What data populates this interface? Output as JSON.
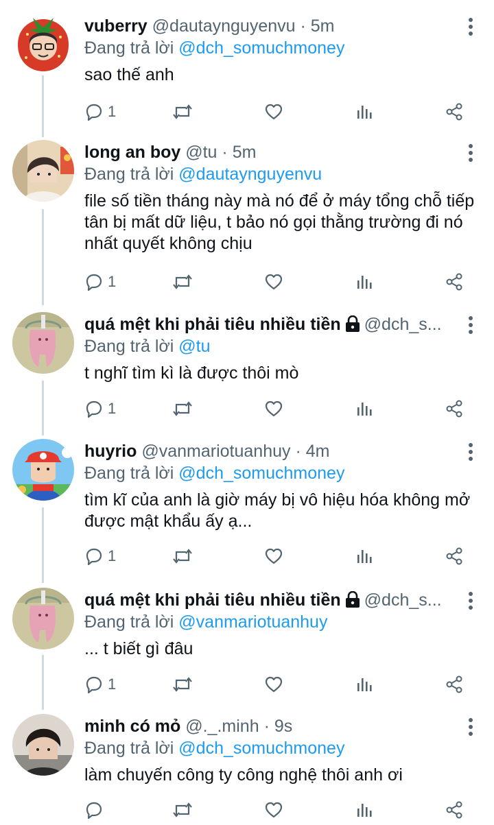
{
  "tweets": [
    {
      "name": "vuberry",
      "handle": "@dautaynguyenvu",
      "time": "· 5m",
      "reply_label": "Đang trả lời",
      "reply_to": "@dch_somuchmoney",
      "text": "sao thế anh",
      "reply_count": "1",
      "avatar_icon": "strawberry-avatar-icon",
      "locked": false
    },
    {
      "name": "long an boy",
      "handle": "@tu",
      "time": "· 5m",
      "reply_label": "Đang trả lời",
      "reply_to": "@dautaynguyenvu",
      "text": "file số tiền tháng này mà nó để ở máy tổng chỗ tiếp tân bị mất dữ liệu, t bảo nó gọi thằng trường đi nó nhất quyết không chịu",
      "reply_count": "1",
      "avatar_icon": "person-photo-avatar-icon",
      "locked": false
    },
    {
      "name": "quá mệt khi phải tiêu nhiều tiền",
      "handle": "@dch_s...",
      "time": "",
      "reply_label": "Đang trả lời",
      "reply_to": "@tu",
      "text": "t nghĩ tìm kì là được thôi mò",
      "reply_count": "1",
      "avatar_icon": "pink-figure-avatar-icon",
      "locked": true
    },
    {
      "name": "huyrio",
      "handle": "@vanmariotuanhuy",
      "time": "· 4m",
      "reply_label": "Đang trả lời",
      "reply_to": "@dch_somuchmoney",
      "text": "tìm kĩ của anh là giờ máy bị vô hiệu hóa không mở được mật khẩu ấy ạ...",
      "reply_count": "1",
      "avatar_icon": "mario-avatar-icon",
      "locked": false
    },
    {
      "name": "quá mệt khi phải tiêu nhiều tiền",
      "handle": "@dch_s...",
      "time": "",
      "reply_label": "Đang trả lời",
      "reply_to": "@vanmariotuanhuy",
      "text": "... t biết gì đâu",
      "reply_count": "1",
      "avatar_icon": "pink-figure-avatar-icon",
      "locked": true
    },
    {
      "name": "minh có mỏ",
      "handle": "@._.minh",
      "time": "· 9s",
      "reply_label": "Đang trả lời",
      "reply_to": "@dch_somuchmoney",
      "text": "làm chuyến công ty công nghệ thôi anh ơi",
      "reply_count": "",
      "avatar_icon": "person-photo-avatar-icon",
      "locked": false
    }
  ],
  "colors": {
    "link": "#1d9bf0",
    "muted": "#536471",
    "text": "#0f1419",
    "thread_line": "#cfd9de"
  },
  "action_icons": [
    "reply-icon",
    "retweet-icon",
    "like-icon",
    "views-icon",
    "share-icon"
  ]
}
